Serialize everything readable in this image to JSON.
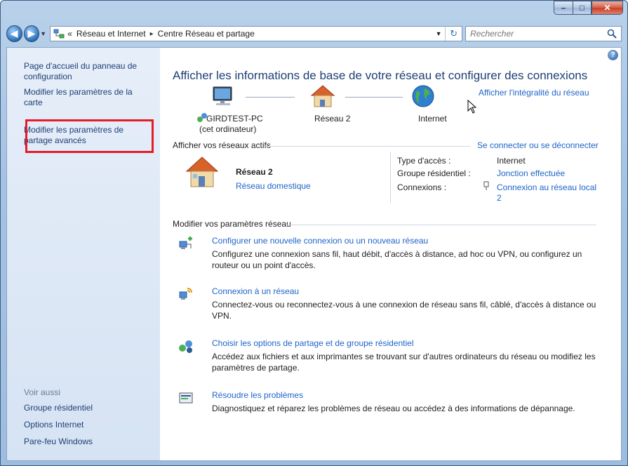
{
  "window": {
    "caption_buttons": {
      "minimize": "–",
      "maximize": "□",
      "close": "✕"
    }
  },
  "nav": {
    "back_icon": "back-arrow-icon",
    "forward_icon": "forward-arrow-icon",
    "breadcrumb_prefix": "«",
    "breadcrumbs": [
      "Réseau et Internet",
      "Centre Réseau et partage"
    ],
    "separator": "▸",
    "search_placeholder": "Rechercher"
  },
  "sidebar": {
    "links": [
      "Page d'accueil du panneau de configuration",
      "Modifier les paramètres de la carte",
      "Modifier les paramètres de partage avancés"
    ],
    "see_also_title": "Voir aussi",
    "see_also": [
      "Groupe résidentiel",
      "Options Internet",
      "Pare-feu Windows"
    ],
    "highlight_color": "#e51d27"
  },
  "main": {
    "heading": "Afficher les informations de base de votre réseau et configurer des connexions",
    "full_map_link": "Afficher l'intégralité du réseau",
    "map": {
      "computer_name": "GIRDTEST-PC",
      "computer_sub": "(cet ordinateur)",
      "network_name": "Réseau 2",
      "internet": "Internet"
    },
    "active_networks": {
      "section_title": "Afficher vos réseaux actifs",
      "connect_link": "Se connecter ou se déconnecter",
      "network_name": "Réseau 2",
      "network_type": "Réseau domestique",
      "access_type_label": "Type d'accès :",
      "access_type_value": "Internet",
      "homegroup_label": "Groupe résidentiel :",
      "homegroup_value": "Jonction effectuée",
      "connections_label": "Connexions :",
      "connections_value": "Connexion au réseau local 2"
    },
    "settings": {
      "section_title": "Modifier vos paramètres réseau",
      "tasks": [
        {
          "icon": "new-connection-icon",
          "title": "Configurer une nouvelle connexion ou un nouveau réseau",
          "desc": "Configurez une connexion sans fil, haut débit, d'accès à distance, ad hoc ou VPN, ou configurez un routeur ou un point d'accès."
        },
        {
          "icon": "connect-network-icon",
          "title": "Connexion à un réseau",
          "desc": "Connectez-vous ou reconnectez-vous à une connexion de réseau sans fil, câblé, d'accès à distance ou VPN."
        },
        {
          "icon": "sharing-options-icon",
          "title": "Choisir les options de partage et de groupe résidentiel",
          "desc": "Accédez aux fichiers et aux imprimantes se trouvant sur d'autres ordinateurs du réseau ou modifiez les paramètres de partage."
        },
        {
          "icon": "troubleshoot-icon",
          "title": "Résoudre les problèmes",
          "desc": "Diagnostiquez et réparez les problèmes de réseau ou accédez à des informations de dépannage."
        }
      ]
    }
  }
}
